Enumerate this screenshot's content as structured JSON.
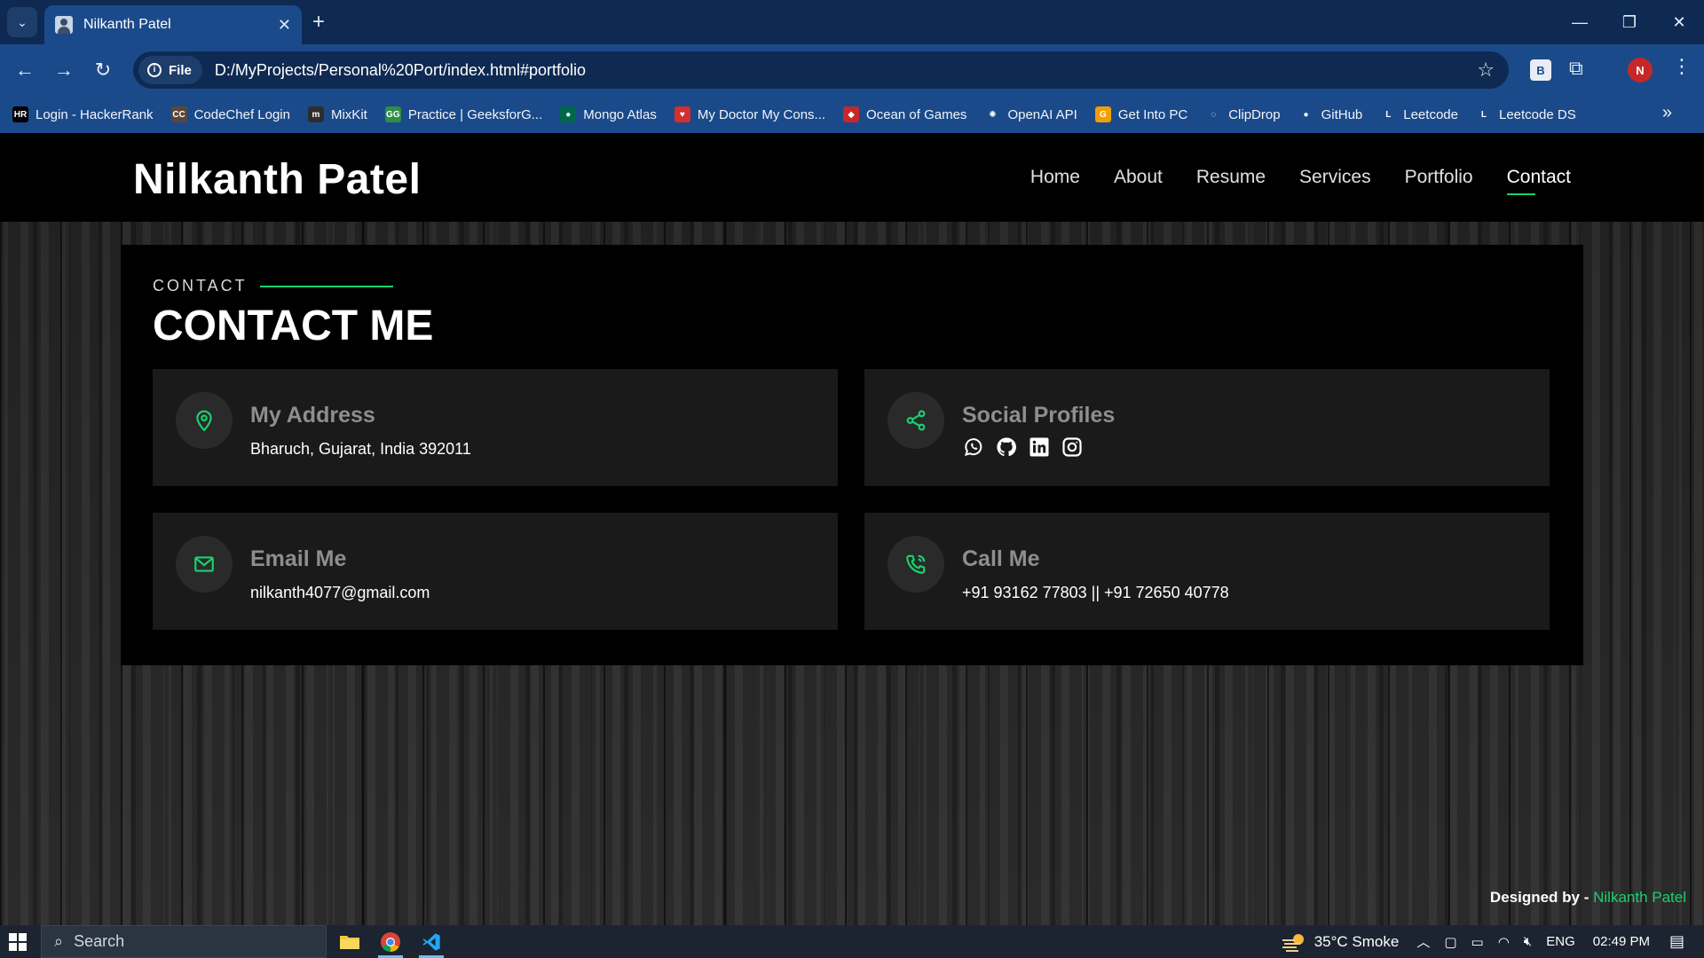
{
  "browser": {
    "tab_title": "Nilkanth Patel",
    "url_chip": "File",
    "url": "D:/MyProjects/Personal%20Port/index.html#portfolio",
    "profile_initial": "N",
    "extension_label": "B",
    "bookmarks": [
      {
        "label": "Login - HackerRank",
        "icon": "HR",
        "color": "#000000"
      },
      {
        "label": "CodeChef Login",
        "icon": "CC",
        "color": "#5b4638"
      },
      {
        "label": "MixKit",
        "icon": "m",
        "color": "#2d2d2d"
      },
      {
        "label": "Practice | GeeksforG...",
        "icon": "GG",
        "color": "#2f8d46"
      },
      {
        "label": "Mongo Atlas",
        "icon": "●",
        "color": "#00684a"
      },
      {
        "label": "My Doctor My Cons...",
        "icon": "♥",
        "color": "#d32f2f"
      },
      {
        "label": "Ocean of Games",
        "icon": "◆",
        "color": "#c62828"
      },
      {
        "label": "OpenAI API",
        "icon": "✺",
        "color": "#1a4a8a"
      },
      {
        "label": "Get Into PC",
        "icon": "G",
        "color": "#f0a000"
      },
      {
        "label": "ClipDrop",
        "icon": "◌",
        "color": "#1a4a8a"
      },
      {
        "label": "GitHub",
        "icon": "●",
        "color": "#1a4a8a"
      },
      {
        "label": "Leetcode",
        "icon": "L",
        "color": "#1a4a8a"
      },
      {
        "label": "Leetcode DS",
        "icon": "L",
        "color": "#1a4a8a"
      }
    ]
  },
  "site": {
    "logo": "Nilkanth Patel",
    "nav": [
      "Home",
      "About",
      "Resume",
      "Services",
      "Portfolio",
      "Contact"
    ],
    "active_nav": "Contact",
    "accent_color": "#18d26e"
  },
  "contact": {
    "label": "CONTACT",
    "title": "CONTACT ME",
    "address": {
      "title": "My Address",
      "text": "Bharuch, Gujarat, India 392011",
      "icon": "map-pin-icon"
    },
    "social": {
      "title": "Social Profiles",
      "icons": [
        "whatsapp-icon",
        "github-icon",
        "linkedin-icon",
        "instagram-icon"
      ]
    },
    "email": {
      "title": "Email Me",
      "text": "nilkanth4077@gmail.com",
      "icon": "envelope-icon"
    },
    "call": {
      "title": "Call Me",
      "text": "+91 93162 77803 || +91 72650 40778",
      "icon": "phone-icon"
    }
  },
  "footer": {
    "prefix": "Designed by - ",
    "name": "Nilkanth Patel"
  },
  "taskbar": {
    "search_placeholder": "Search",
    "weather": "35°C  Smoke",
    "language": "ENG",
    "time": "02:49 PM"
  }
}
